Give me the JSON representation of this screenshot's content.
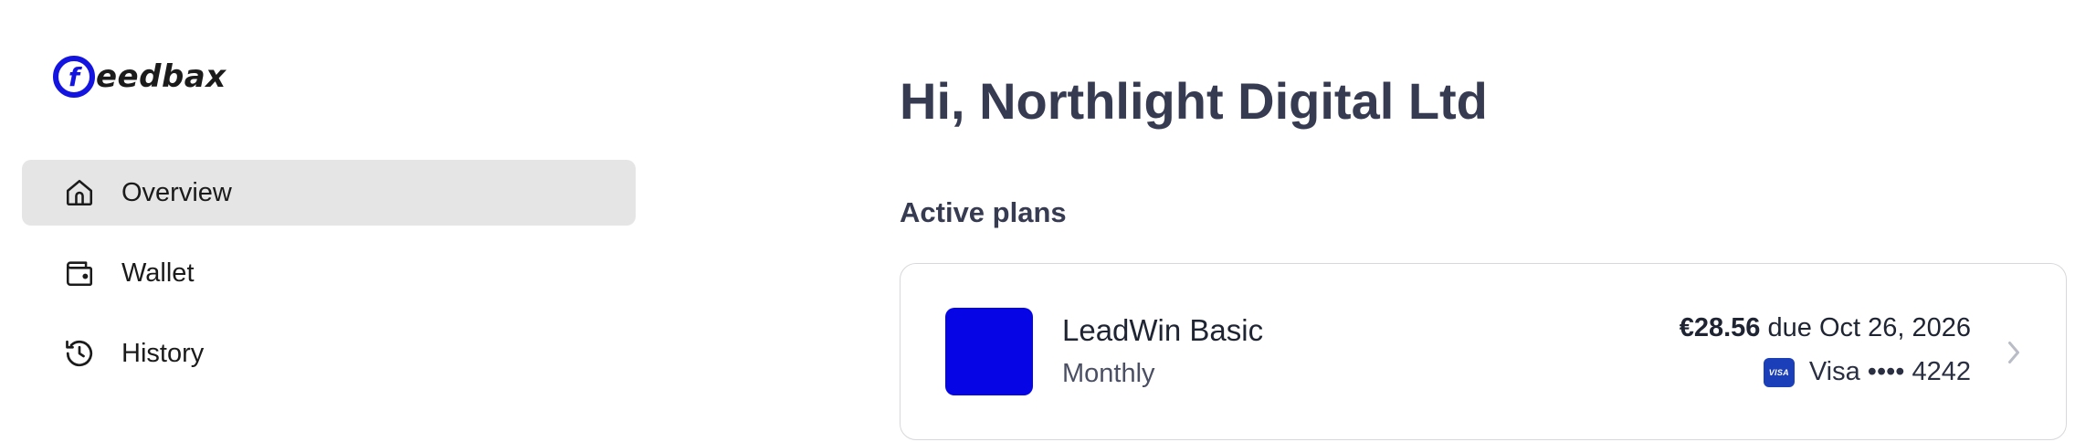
{
  "brand": {
    "logo_letter": "f",
    "logo_text": "eedbax",
    "accent_color": "#1414e0"
  },
  "sidebar": {
    "items": [
      {
        "label": "Overview",
        "icon": "home-icon",
        "active": true
      },
      {
        "label": "Wallet",
        "icon": "wallet-icon",
        "active": false
      },
      {
        "label": "History",
        "icon": "history-icon",
        "active": false
      }
    ]
  },
  "main": {
    "greeting": "Hi, Northlight Digital Ltd",
    "section_title": "Active plans",
    "plans": [
      {
        "name": "LeadWin Basic",
        "period": "Monthly",
        "amount": "€28.56",
        "due_text": "due Oct 26, 2026",
        "card_brand": "VISA",
        "card_text": "Visa •••• 4242",
        "thumb_color": "#0505e6",
        "icon": "chevron-right-icon"
      }
    ]
  }
}
